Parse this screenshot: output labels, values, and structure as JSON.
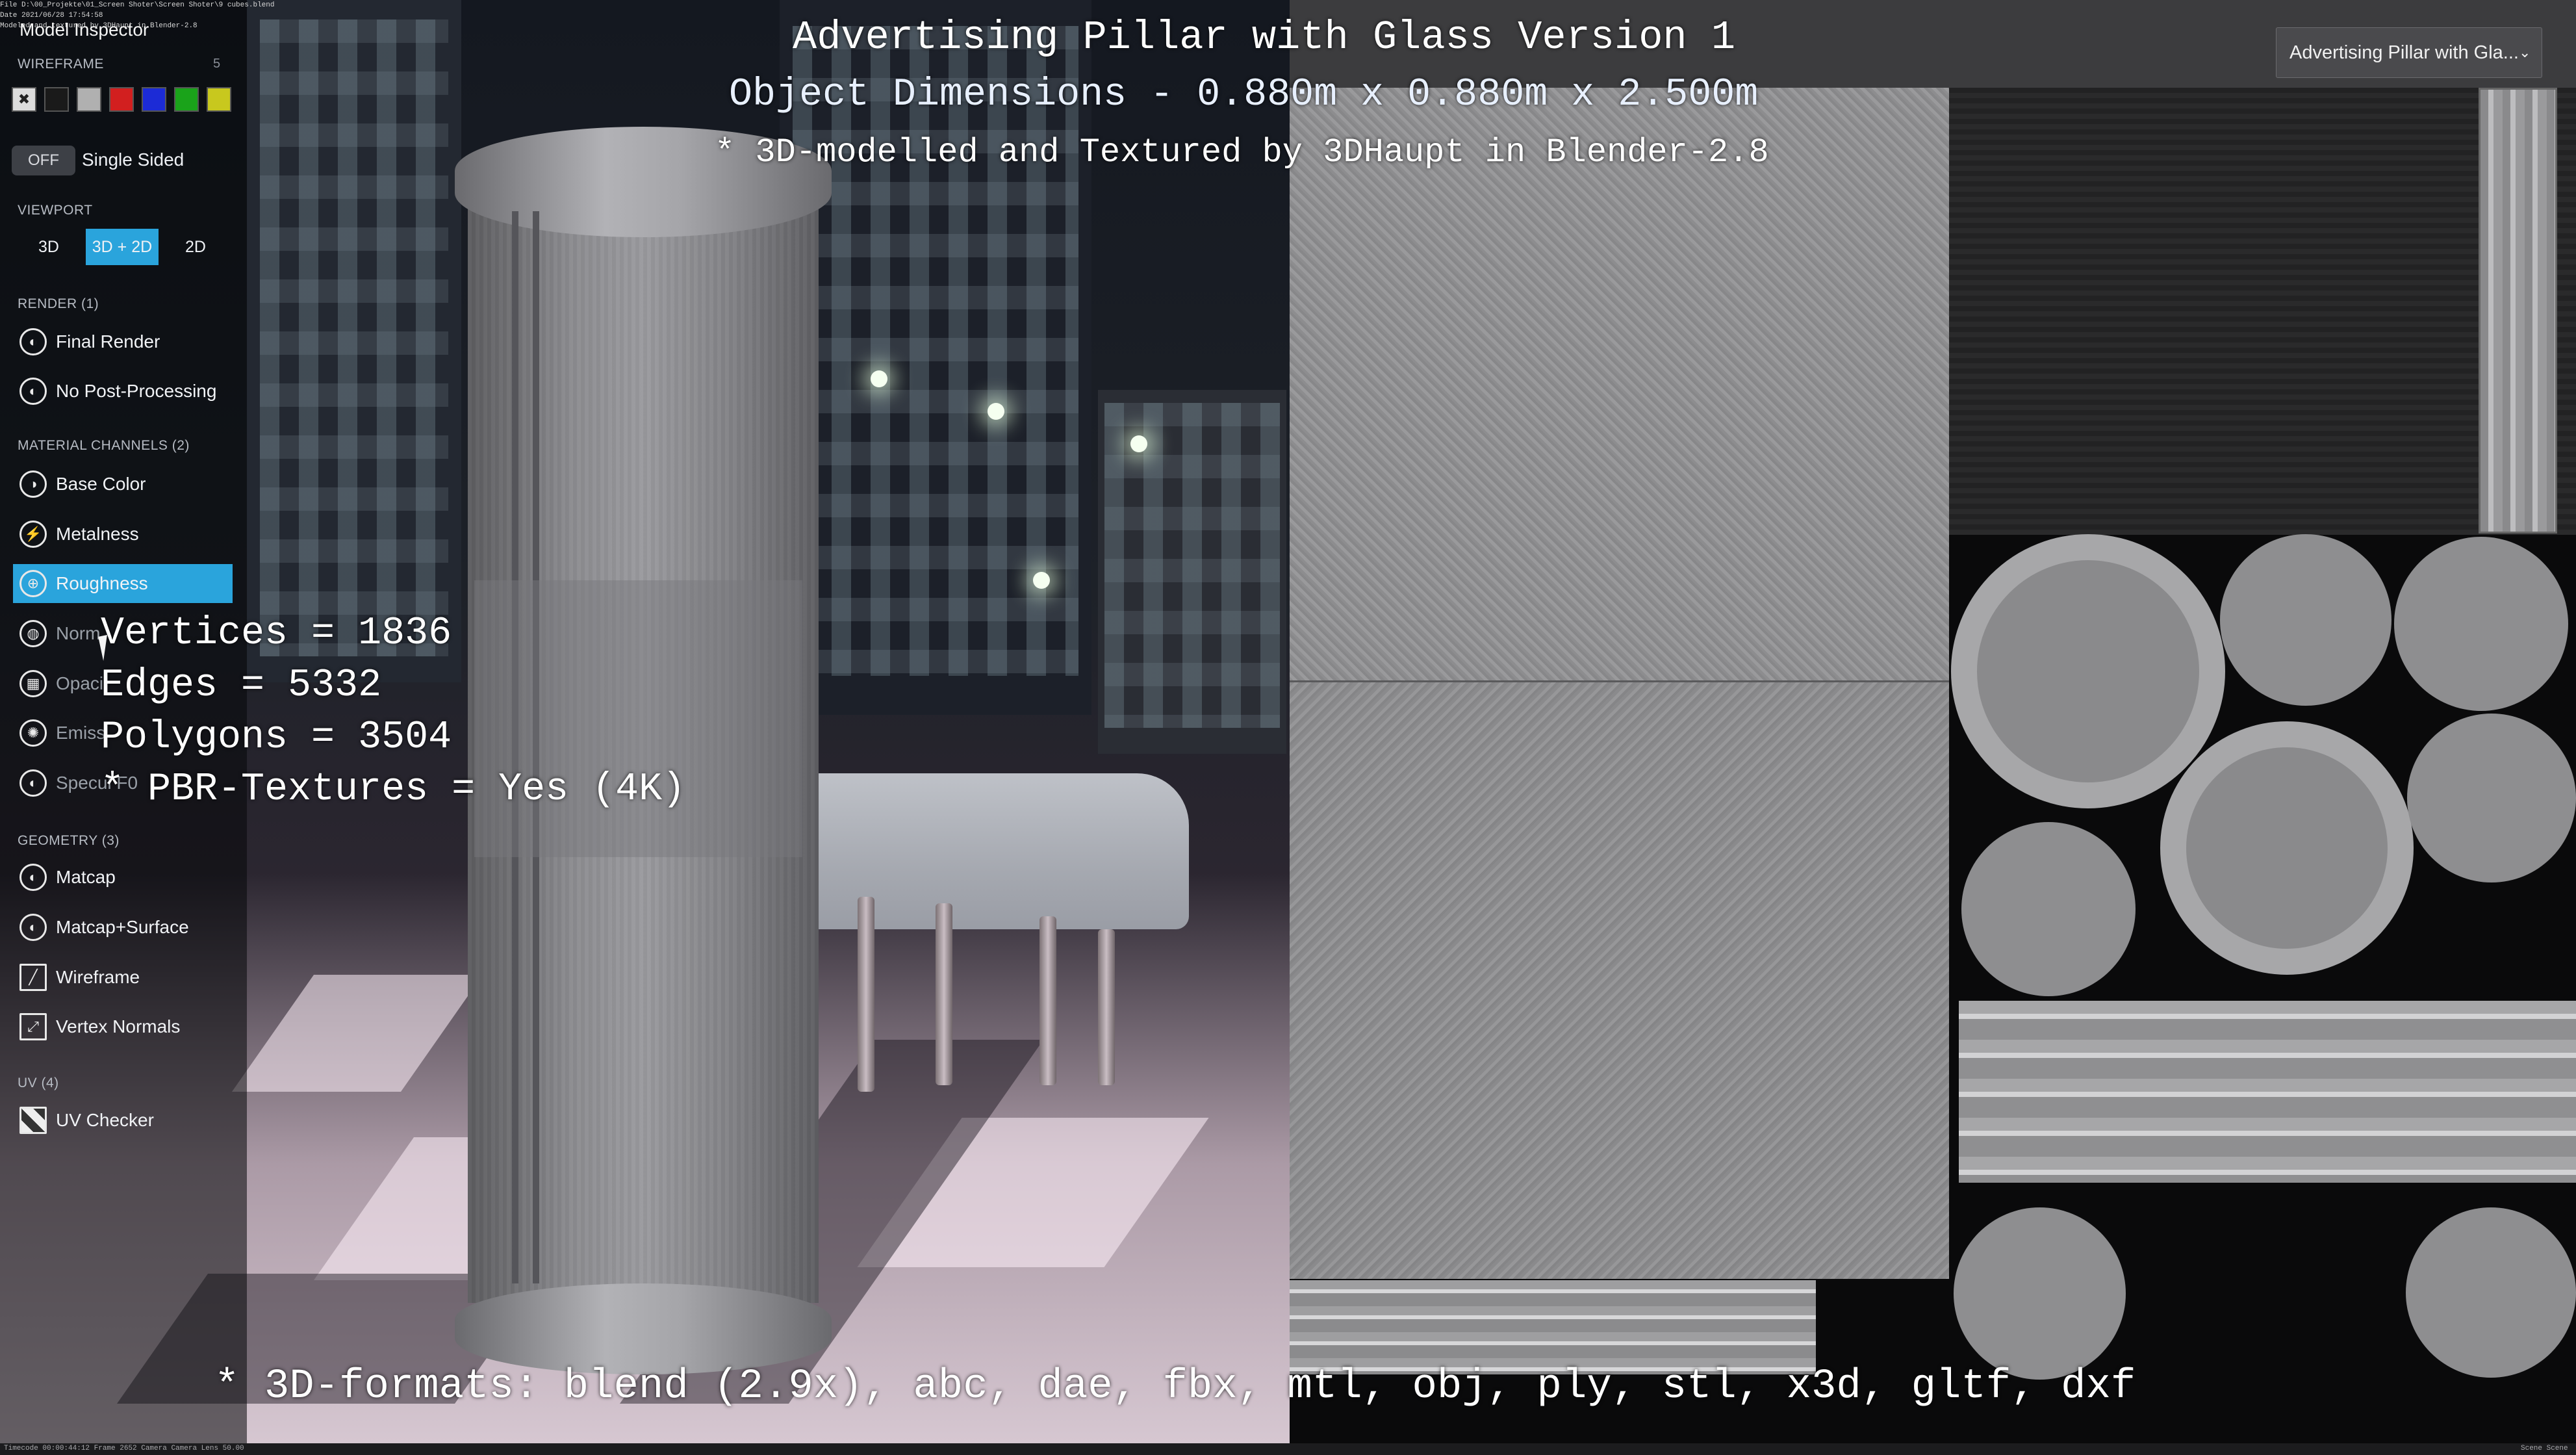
{
  "overlay": {
    "title": "Advertising Pillar with Glass Version 1",
    "dimensions": "Object Dimensions - 0.880m x 0.880m x 2.500m",
    "credit": "* 3D-modelled and Textured by 3DHaupt in Blender-2.8",
    "stats": {
      "vertices": "Vertices = 1836",
      "edges": "Edges = 5332",
      "polygons": "Polygons = 3504",
      "textures": "* PBR-Textures =  Yes (4K)"
    },
    "formats": "* 3D-formats: blend (2.9x), abc, dae, fbx, mtl, obj, ply, stl, x3d, gltf, dxf"
  },
  "file_info": [
    "File D:\\00_Projekte\\01_Screen Shoter\\Screen Shoter\\9 cubes.blend",
    "Date 2021/06/28 17:54:58",
    "Modeled and textured by 3DHaupt in Blender-2.8"
  ],
  "sidebar": {
    "title": "Model Inspector",
    "wireframe": {
      "label": "WIREFRAME",
      "count": "5",
      "swatches": [
        "#1a1a1a",
        "#b0b0b0",
        "#d21f1f",
        "#1c2bd6",
        "#1aa31a",
        "#c8c81e"
      ]
    },
    "single_sided": {
      "toggle": "OFF",
      "label": "Single Sided"
    },
    "viewport": {
      "label": "VIEWPORT",
      "options": [
        "3D",
        "3D + 2D",
        "2D"
      ],
      "selected": "3D + 2D"
    },
    "render": {
      "label": "RENDER (1)",
      "items": [
        "Final Render",
        "No Post-Processing"
      ]
    },
    "material": {
      "label": "MATERIAL CHANNELS (2)",
      "items": [
        "Base Color",
        "Metalness",
        "Roughness",
        "Norm",
        "Opaci",
        "Emiss",
        "Specul  F0"
      ],
      "selected": "Roughness"
    },
    "geometry": {
      "label": "GEOMETRY (3)",
      "items": [
        "Matcap",
        "Matcap+Surface",
        "Wireframe",
        "Vertex Normals"
      ]
    },
    "uv": {
      "label": "UV (4)",
      "items": [
        "UV Checker"
      ]
    }
  },
  "dropdown": {
    "value": "Advertising Pillar with Gla..."
  },
  "statusbar": {
    "left": "Timecode 00:00:44:12   Frame 2652   Camera Camera   Lens 50.00",
    "right": "Scene Scene"
  },
  "colors": {
    "accent": "#2aa4dc",
    "sidebar_bg": "#05070a",
    "uv_bg": "#0a0a0b"
  }
}
